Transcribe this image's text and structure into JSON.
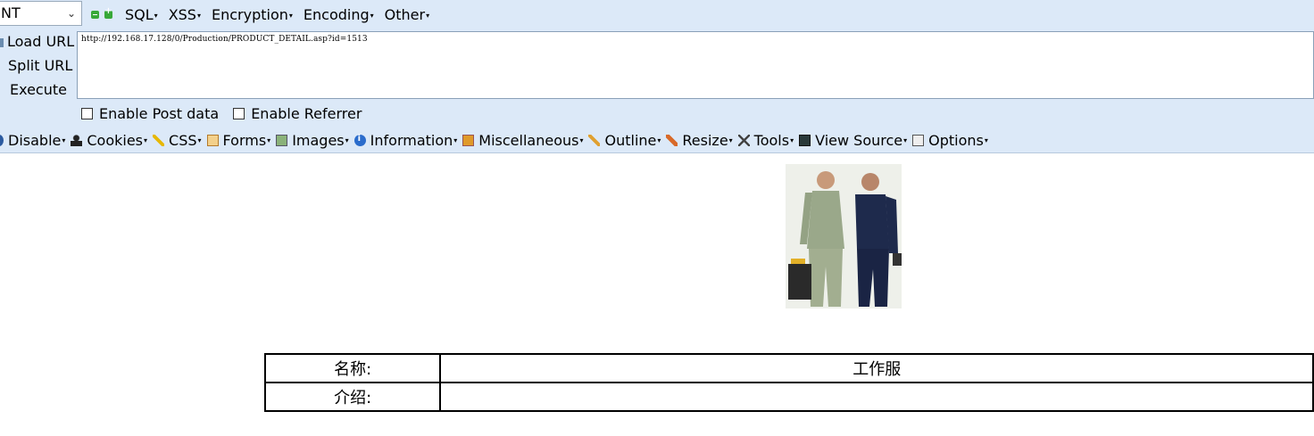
{
  "toolbar": {
    "select_value": "NT",
    "menu1": [
      {
        "label": "SQL"
      },
      {
        "label": "XSS"
      },
      {
        "label": "Encryption"
      },
      {
        "label": "Encoding"
      },
      {
        "label": "Other"
      }
    ],
    "side_buttons": {
      "load_url": "Load URL",
      "split_url": "Split URL",
      "execute": "Execute"
    },
    "url": "http://192.168.17.128/0/Production/PRODUCT_DETAIL.asp?id=1513",
    "enable_post_data": "Enable Post data",
    "enable_referrer": "Enable Referrer",
    "menu2": [
      {
        "label": "Disable",
        "icon": "disable-icon"
      },
      {
        "label": "Cookies",
        "icon": "cookies-icon"
      },
      {
        "label": "CSS",
        "icon": "css-icon"
      },
      {
        "label": "Forms",
        "icon": "forms-icon"
      },
      {
        "label": "Images",
        "icon": "images-icon"
      },
      {
        "label": "Information",
        "icon": "information-icon"
      },
      {
        "label": "Miscellaneous",
        "icon": "miscellaneous-icon"
      },
      {
        "label": "Outline",
        "icon": "outline-icon"
      },
      {
        "label": "Resize",
        "icon": "resize-icon"
      },
      {
        "label": "Tools",
        "icon": "tools-icon"
      },
      {
        "label": "View Source",
        "icon": "view-source-icon"
      },
      {
        "label": "Options",
        "icon": "options-icon"
      }
    ]
  },
  "product": {
    "rows": [
      {
        "label": "名称:",
        "value": "工作服"
      },
      {
        "label": "介绍:",
        "value": ""
      }
    ]
  },
  "colors": {
    "toolbar_bg": "#dce9f8",
    "page_bg": "#ffffff"
  }
}
